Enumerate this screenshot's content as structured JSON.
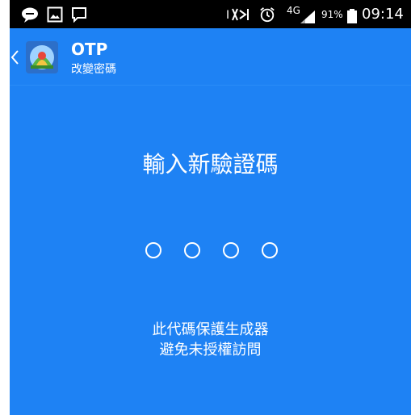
{
  "status_bar": {
    "network": "4G",
    "battery_percent": "91%",
    "time": "09:14",
    "icons": [
      "chat-bubble-icon",
      "image-icon",
      "message-icon",
      "mute-icon",
      "alarm-icon",
      "signal-icon",
      "battery-icon"
    ]
  },
  "app_bar": {
    "title": "OTP",
    "subtitle": "改變密碼"
  },
  "main": {
    "prompt": "輸入新驗證碼",
    "pin_length": 4,
    "info_line1": "此代碼保護生成器",
    "info_line2": "避免未授權訪問"
  },
  "colors": {
    "background": "#1e82f4",
    "status_bar": "#000000",
    "text": "#ffffff"
  }
}
